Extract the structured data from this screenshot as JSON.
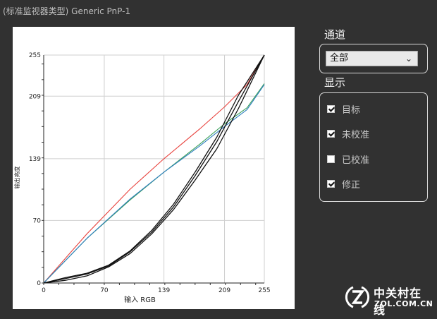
{
  "window": {
    "title": "(标准监视器类型) Generic PnP-1"
  },
  "channel": {
    "label": "通道",
    "selected": "全部"
  },
  "display": {
    "label": "显示",
    "items": [
      {
        "label": "目标",
        "checked": true
      },
      {
        "label": "未校准",
        "checked": true
      },
      {
        "label": "已校准",
        "checked": false
      },
      {
        "label": "修正",
        "checked": true
      }
    ]
  },
  "watermark": {
    "brand": "中关村在线",
    "url": "ZOL.COM.CN"
  },
  "chart_data": {
    "type": "line",
    "xlabel": "输入 RGB",
    "ylabel": "输出亮度",
    "xlim": [
      0,
      255
    ],
    "ylim": [
      0,
      255
    ],
    "grid": true,
    "x_ticks": [
      0,
      70,
      139,
      209,
      255
    ],
    "y_ticks": [
      0,
      70,
      139,
      209,
      255
    ],
    "colors": {
      "red": "#e8413c",
      "green": "#3aa05a",
      "blue": "#2f7fc0",
      "black": "#111111"
    },
    "series": [
      {
        "color": "#e8413c",
        "x": [
          0,
          50,
          100,
          139,
          180,
          209,
          235,
          255
        ],
        "y": [
          0,
          55,
          105,
          139,
          172,
          197,
          222,
          255
        ]
      },
      {
        "color": "#3aa05a",
        "x": [
          0,
          50,
          100,
          139,
          180,
          209,
          235,
          255
        ],
        "y": [
          0,
          50,
          93,
          124,
          155,
          178,
          196,
          223
        ]
      },
      {
        "color": "#2f7fc0",
        "x": [
          0,
          50,
          100,
          139,
          180,
          209,
          235,
          255
        ],
        "y": [
          0,
          50,
          94,
          124,
          153,
          175,
          194,
          222
        ]
      },
      {
        "color": "#111111",
        "x": [
          0,
          25,
          50,
          75,
          100,
          125,
          150,
          175,
          200,
          225,
          255
        ],
        "y": [
          0,
          5,
          10,
          19,
          35,
          57,
          85,
          120,
          158,
          203,
          255
        ]
      },
      {
        "color": "#111111",
        "x": [
          0,
          25,
          50,
          75,
          100,
          125,
          150,
          175,
          200,
          225,
          255
        ],
        "y": [
          0,
          3,
          8,
          18,
          33,
          55,
          82,
          115,
          150,
          195,
          255
        ]
      },
      {
        "color": "#111111",
        "x": [
          0,
          25,
          50,
          75,
          100,
          125,
          150,
          175,
          200,
          225,
          255
        ],
        "y": [
          0,
          6,
          11,
          20,
          36,
          59,
          88,
          124,
          163,
          210,
          255
        ]
      }
    ]
  }
}
